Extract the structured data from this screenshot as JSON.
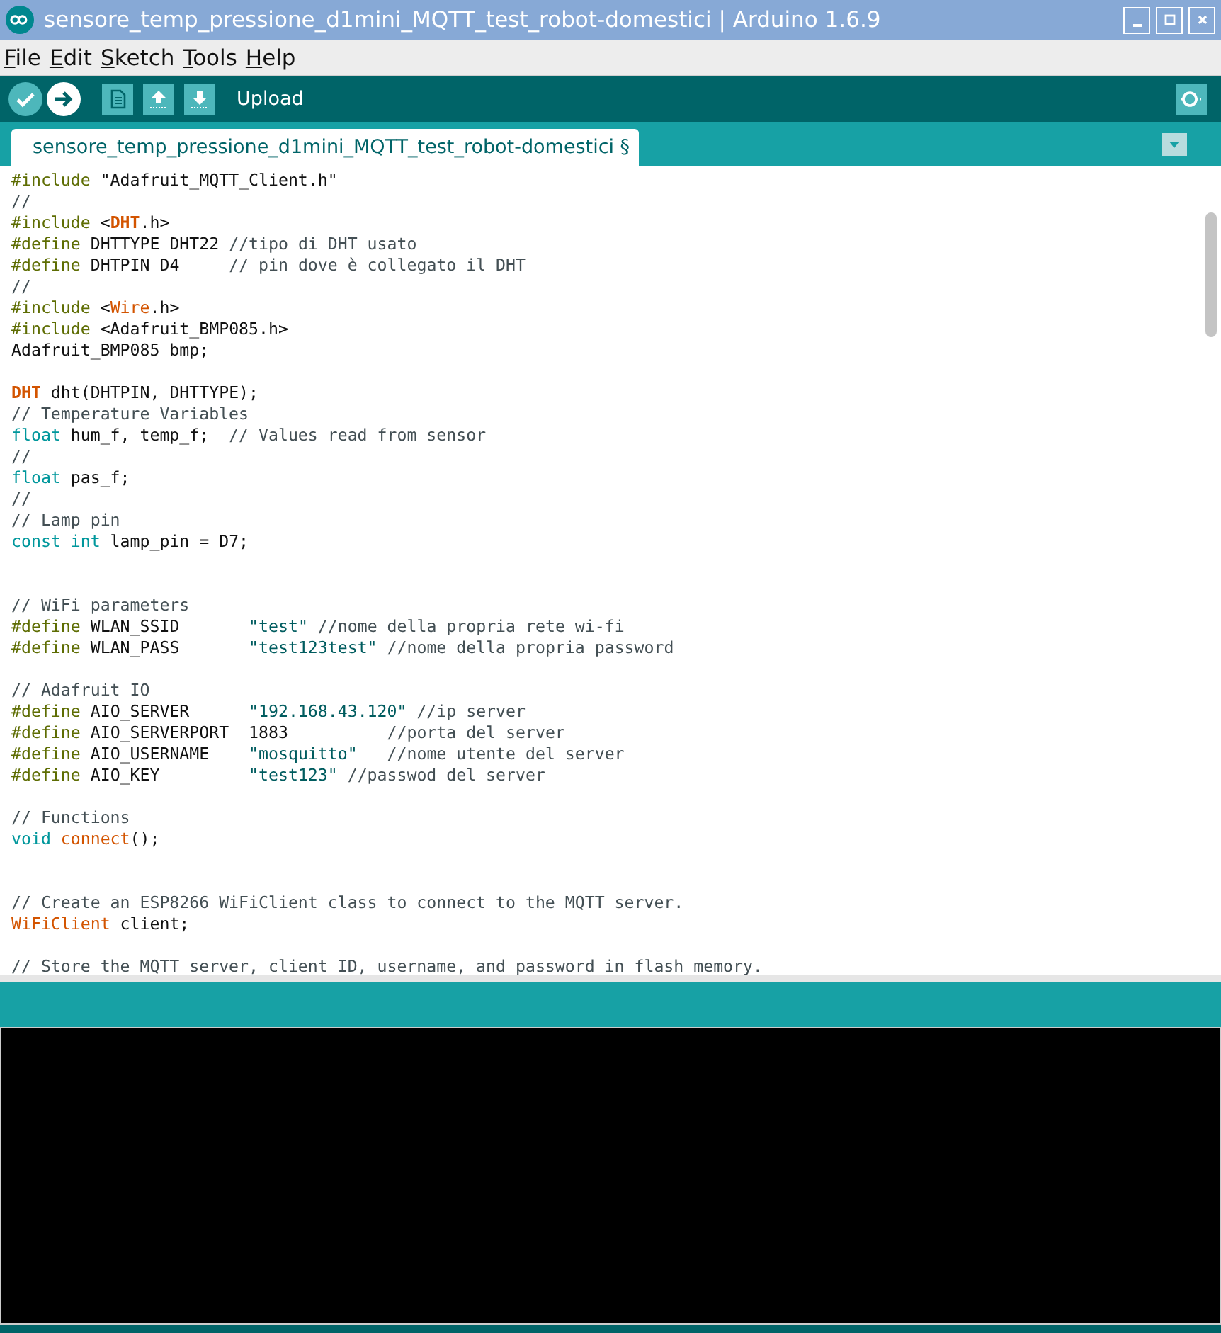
{
  "window": {
    "title": "sensore_temp_pressione_d1mini_MQTT_test_robot-domestici | Arduino 1.6.9"
  },
  "menu": [
    "File",
    "Edit",
    "Sketch",
    "Tools",
    "Help"
  ],
  "toolbar": {
    "buttons": [
      {
        "kind": "verify",
        "selected": false
      },
      {
        "kind": "upload",
        "selected": true
      },
      {
        "kind": "new",
        "selected": false
      },
      {
        "kind": "open",
        "selected": false
      },
      {
        "kind": "save",
        "selected": false
      }
    ],
    "label": "Upload"
  },
  "tabs": [
    {
      "label": "sensore_temp_pressione_d1mini_MQTT_test_robot-domestici §",
      "selected": true
    }
  ],
  "editor": {
    "lines": [
      {
        "kind": "code",
        "tokens": [
          {
            "kind": "directive",
            "text": "#include"
          },
          {
            "kind": "plain",
            "text": " \"Adafruit_MQTT_Client.h\""
          }
        ]
      },
      {
        "kind": "code",
        "tokens": [
          {
            "kind": "comment",
            "text": "//"
          }
        ]
      },
      {
        "kind": "code",
        "tokens": [
          {
            "kind": "directive",
            "text": "#include"
          },
          {
            "kind": "plain",
            "text": " <"
          },
          {
            "kind": "type",
            "text": "DHT"
          },
          {
            "kind": "plain",
            "text": ".h>"
          }
        ]
      },
      {
        "kind": "code",
        "tokens": [
          {
            "kind": "directive",
            "text": "#define"
          },
          {
            "kind": "plain",
            "text": " DHTTYPE DHT22"
          },
          {
            "kind": "comment",
            "text": " //tipo di DHT usato"
          }
        ]
      },
      {
        "kind": "code",
        "tokens": [
          {
            "kind": "directive",
            "text": "#define"
          },
          {
            "kind": "plain",
            "text": " DHTPIN D4"
          },
          {
            "kind": "comment",
            "text": "     // pin dove è collegato il DHT"
          }
        ]
      },
      {
        "kind": "code",
        "tokens": [
          {
            "kind": "comment",
            "text": "//"
          }
        ]
      },
      {
        "kind": "code",
        "tokens": [
          {
            "kind": "directive",
            "text": "#include"
          },
          {
            "kind": "plain",
            "text": " <"
          },
          {
            "kind": "function",
            "text": "Wire"
          },
          {
            "kind": "plain",
            "text": ".h>"
          }
        ]
      },
      {
        "kind": "code",
        "tokens": [
          {
            "kind": "directive",
            "text": "#include"
          },
          {
            "kind": "plain",
            "text": " <Adafruit_BMP085.h>"
          }
        ]
      },
      {
        "kind": "code",
        "tokens": [
          {
            "kind": "plain",
            "text": "Adafruit_BMP085 bmp;"
          }
        ]
      },
      {
        "kind": "blank"
      },
      {
        "kind": "code",
        "tokens": [
          {
            "kind": "type",
            "text": "DHT"
          },
          {
            "kind": "plain",
            "text": " dht(DHTPIN, DHTTYPE);"
          }
        ]
      },
      {
        "kind": "code",
        "tokens": [
          {
            "kind": "comment",
            "text": "// Temperature Variables"
          }
        ]
      },
      {
        "kind": "code",
        "tokens": [
          {
            "kind": "keyword",
            "text": "float"
          },
          {
            "kind": "plain",
            "text": " hum_f, temp_f;"
          },
          {
            "kind": "comment",
            "text": "  // Values read from sensor"
          }
        ]
      },
      {
        "kind": "code",
        "tokens": [
          {
            "kind": "comment",
            "text": "//"
          }
        ]
      },
      {
        "kind": "code",
        "tokens": [
          {
            "kind": "keyword",
            "text": "float"
          },
          {
            "kind": "plain",
            "text": " pas_f;"
          }
        ]
      },
      {
        "kind": "code",
        "tokens": [
          {
            "kind": "comment",
            "text": "//"
          }
        ]
      },
      {
        "kind": "code",
        "tokens": [
          {
            "kind": "comment",
            "text": "// Lamp pin"
          }
        ]
      },
      {
        "kind": "code",
        "tokens": [
          {
            "kind": "keyword",
            "text": "const int"
          },
          {
            "kind": "plain",
            "text": " lamp_pin = D7;"
          }
        ]
      },
      {
        "kind": "blank"
      },
      {
        "kind": "blank"
      },
      {
        "kind": "code",
        "tokens": [
          {
            "kind": "comment",
            "text": "// WiFi parameters"
          }
        ]
      },
      {
        "kind": "code",
        "tokens": [
          {
            "kind": "directive",
            "text": "#define"
          },
          {
            "kind": "plain",
            "text": " WLAN_SSID"
          },
          {
            "kind": "string",
            "text": "       \"test\""
          },
          {
            "kind": "comment",
            "text": " //nome della propria rete wi-fi"
          }
        ]
      },
      {
        "kind": "code",
        "tokens": [
          {
            "kind": "directive",
            "text": "#define"
          },
          {
            "kind": "plain",
            "text": " WLAN_PASS"
          },
          {
            "kind": "string",
            "text": "       \"test123test\""
          },
          {
            "kind": "comment",
            "text": " //nome della propria password"
          }
        ]
      },
      {
        "kind": "blank"
      },
      {
        "kind": "code",
        "tokens": [
          {
            "kind": "comment",
            "text": "// Adafruit IO"
          }
        ]
      },
      {
        "kind": "code",
        "tokens": [
          {
            "kind": "directive",
            "text": "#define"
          },
          {
            "kind": "plain",
            "text": " AIO_SERVER"
          },
          {
            "kind": "string",
            "text": "      \"192.168.43.120\""
          },
          {
            "kind": "comment",
            "text": " //ip server"
          }
        ]
      },
      {
        "kind": "code",
        "tokens": [
          {
            "kind": "directive",
            "text": "#define"
          },
          {
            "kind": "plain",
            "text": " AIO_SERVERPORT  1883"
          },
          {
            "kind": "comment",
            "text": "          //porta del server"
          }
        ]
      },
      {
        "kind": "code",
        "tokens": [
          {
            "kind": "directive",
            "text": "#define"
          },
          {
            "kind": "plain",
            "text": " AIO_USERNAME"
          },
          {
            "kind": "string",
            "text": "    \"mosquitto\""
          },
          {
            "kind": "comment",
            "text": "   //nome utente del server"
          }
        ]
      },
      {
        "kind": "code",
        "tokens": [
          {
            "kind": "directive",
            "text": "#define"
          },
          {
            "kind": "plain",
            "text": " AIO_KEY"
          },
          {
            "kind": "string",
            "text": "         \"test123\""
          },
          {
            "kind": "comment",
            "text": " //passwod del server"
          }
        ]
      },
      {
        "kind": "blank"
      },
      {
        "kind": "code",
        "tokens": [
          {
            "kind": "comment",
            "text": "// Functions"
          }
        ]
      },
      {
        "kind": "code",
        "tokens": [
          {
            "kind": "keyword",
            "text": "void"
          },
          {
            "kind": "function",
            "text": " connect"
          },
          {
            "kind": "plain",
            "text": "();"
          }
        ]
      },
      {
        "kind": "blank"
      },
      {
        "kind": "blank"
      },
      {
        "kind": "code",
        "tokens": [
          {
            "kind": "comment",
            "text": "// Create an ESP8266 WiFiClient class to connect to the MQTT server."
          }
        ]
      },
      {
        "kind": "code",
        "tokens": [
          {
            "kind": "function",
            "text": "WiFiClient"
          },
          {
            "kind": "plain",
            "text": " client;"
          }
        ]
      },
      {
        "kind": "blank"
      },
      {
        "kind": "code",
        "tokens": [
          {
            "kind": "comment",
            "text": "// Store the MQTT server, client ID, username, and password in flash memory."
          }
        ]
      }
    ]
  }
}
